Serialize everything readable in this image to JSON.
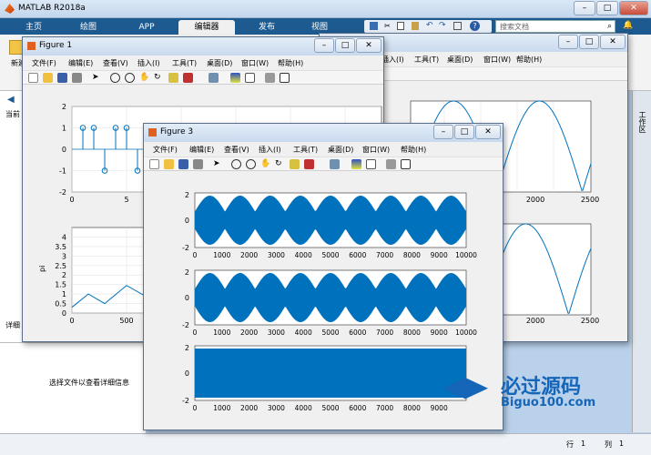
{
  "app": {
    "title": "MATLAB R2018a"
  },
  "ribbon": {
    "tabs": [
      "主页",
      "绘图",
      "APP",
      "编辑器",
      "发布",
      "视图"
    ],
    "active": 3,
    "search_placeholder": "搜索文档",
    "left_label": "新建",
    "left_label2": "当前",
    "detail_label": "详细",
    "side_label": "工作区"
  },
  "status": {
    "row_label": "行",
    "row_value": "1",
    "col_label": "列",
    "col_value": "1"
  },
  "info_text": "选择文件以查看详细信息",
  "menus": [
    "文件(F)",
    "编辑(E)",
    "查看(V)",
    "插入(I)",
    "工具(T)",
    "桌面(D)",
    "窗口(W)",
    "帮助(H)"
  ],
  "figure2": {
    "menus": [
      "插入(I)",
      "工具(T)",
      "桌面(D)",
      "窗口(W)",
      "帮助(H)"
    ]
  },
  "figure1": {
    "title": "Figure 1",
    "stem_y": [
      1,
      1,
      -1,
      1,
      1,
      -1
    ],
    "stem_yticks": [
      "2",
      "1",
      "0",
      "-1",
      "-2"
    ],
    "stem_xticks": [
      "0",
      "5"
    ],
    "line_ylabel": "pi",
    "line_yticks": [
      "4",
      "3.5",
      "3",
      "2.5",
      "2",
      "1.5",
      "1",
      "0.5",
      "0"
    ],
    "line_xticks": [
      "0",
      "500"
    ]
  },
  "figure2_axes": {
    "xticks_top": [
      "2000",
      "2500"
    ],
    "xticks_bottom": [
      "2000",
      "2500"
    ]
  },
  "figure3": {
    "title": "Figure 3",
    "yticks": [
      "2",
      "0",
      "-2"
    ],
    "xticks": [
      "0",
      "1000",
      "2000",
      "3000",
      "4000",
      "5000",
      "6000",
      "7000",
      "8000",
      "9000",
      "10000"
    ],
    "xticks_bottom": [
      "0",
      "1000",
      "2000",
      "3000",
      "4000",
      "5000",
      "6000",
      "7000",
      "8000",
      "9000"
    ],
    "plots": [
      "am",
      "am",
      "carrier"
    ]
  },
  "watermark": {
    "cn": "必过源码",
    "en": "Biguo100.com"
  },
  "colors": {
    "plot": "#0072bd",
    "ribbon": "#1c5a90"
  }
}
